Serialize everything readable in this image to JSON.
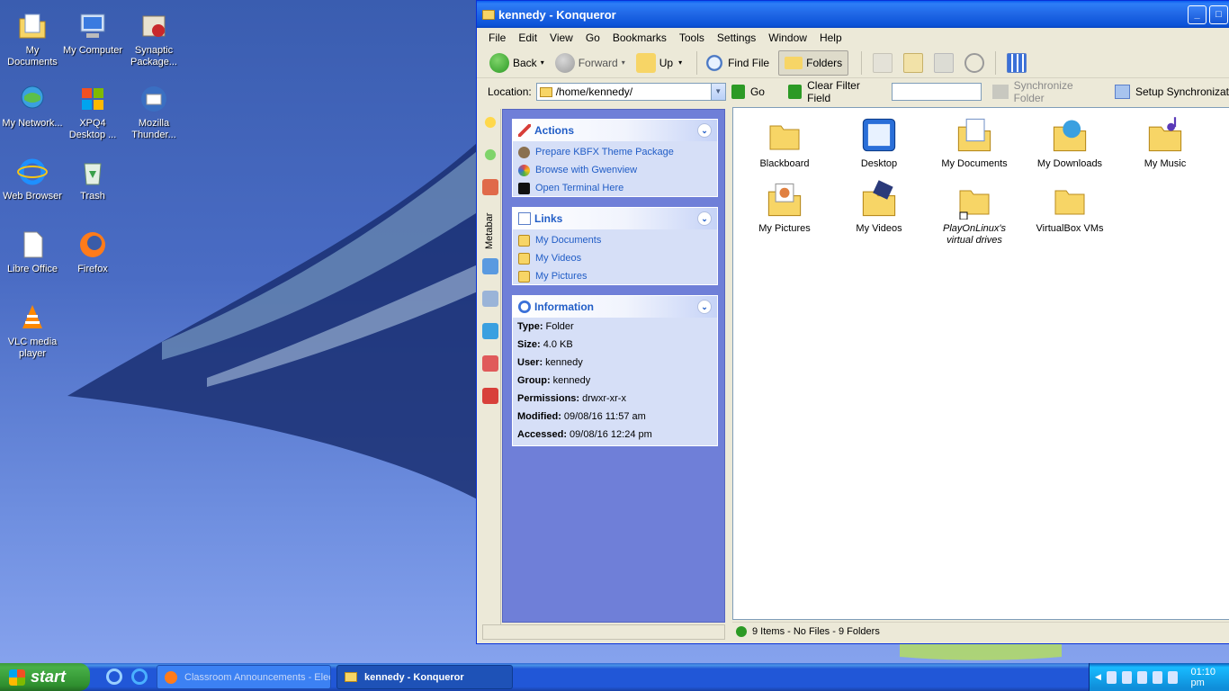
{
  "desktop": {
    "icons": [
      {
        "label": "My Documents",
        "icon": "my-documents-icon"
      },
      {
        "label": "My Computer",
        "icon": "my-computer-icon"
      },
      {
        "label": "Synaptic Package...",
        "icon": "synaptic-icon"
      },
      {
        "label": "My Network...",
        "icon": "network-icon"
      },
      {
        "label": "XPQ4 Desktop ...",
        "icon": "xpq4-icon"
      },
      {
        "label": "Mozilla Thunder...",
        "icon": "thunderbird-icon"
      },
      {
        "label": "Web Browser",
        "icon": "ie-icon"
      },
      {
        "label": "Trash",
        "icon": "trash-icon"
      },
      {
        "label": "Libre Office",
        "icon": "libreoffice-icon"
      },
      {
        "label": "Firefox",
        "icon": "firefox-icon"
      },
      {
        "label": "VLC media player",
        "icon": "vlc-icon"
      }
    ]
  },
  "window": {
    "title": "kennedy - Konqueror",
    "menu": [
      "File",
      "Edit",
      "View",
      "Go",
      "Bookmarks",
      "Tools",
      "Settings",
      "Window",
      "Help"
    ],
    "toolbar": {
      "back": "Back",
      "forward": "Forward",
      "up": "Up",
      "find_file": "Find File",
      "folders": "Folders"
    },
    "location": {
      "label": "Location:",
      "value": "/home/kennedy/",
      "go": "Go",
      "clear_filter": "Clear Filter Field",
      "sync_folder": "Synchronize Folder",
      "setup_sync": "Setup Synchronizat"
    },
    "sidebar_tab_label": "Metabar",
    "metabar": {
      "actions": {
        "title": "Actions",
        "items": [
          "Prepare KBFX Theme Package",
          "Browse with Gwenview",
          "Open Terminal Here"
        ]
      },
      "links": {
        "title": "Links",
        "items": [
          "My Documents",
          "My Videos",
          "My Pictures"
        ]
      },
      "information": {
        "title": "Information",
        "rows": [
          {
            "key": "Type:",
            "value": "Folder"
          },
          {
            "key": "Size:",
            "value": "4.0 KB"
          },
          {
            "key": "User:",
            "value": "kennedy"
          },
          {
            "key": "Group:",
            "value": "kennedy"
          },
          {
            "key": "Permissions:",
            "value": "drwxr-xr-x"
          },
          {
            "key": "Modified:",
            "value": "09/08/16 11:57 am"
          },
          {
            "key": "Accessed:",
            "value": "09/08/16 12:24 pm"
          }
        ]
      }
    },
    "files": [
      {
        "name": "Blackboard"
      },
      {
        "name": "Desktop"
      },
      {
        "name": "My Documents"
      },
      {
        "name": "My Downloads"
      },
      {
        "name": "My Music"
      },
      {
        "name": "My Pictures"
      },
      {
        "name": "My Videos"
      },
      {
        "name": "PlayOnLinux's virtual drives"
      },
      {
        "name": "VirtualBox VMs"
      }
    ],
    "status": "9 Items - No Files - 9 Folders"
  },
  "taskbar": {
    "start": "start",
    "tasks": [
      "Classroom Announcements - Electr",
      "kennedy - Konqueror"
    ],
    "clock": "01:10 pm"
  },
  "colors": {
    "titlebar": "#0b53d8",
    "metabar_bg": "#6f7fd8",
    "link": "#215dc6",
    "folder": "#f7d566"
  }
}
